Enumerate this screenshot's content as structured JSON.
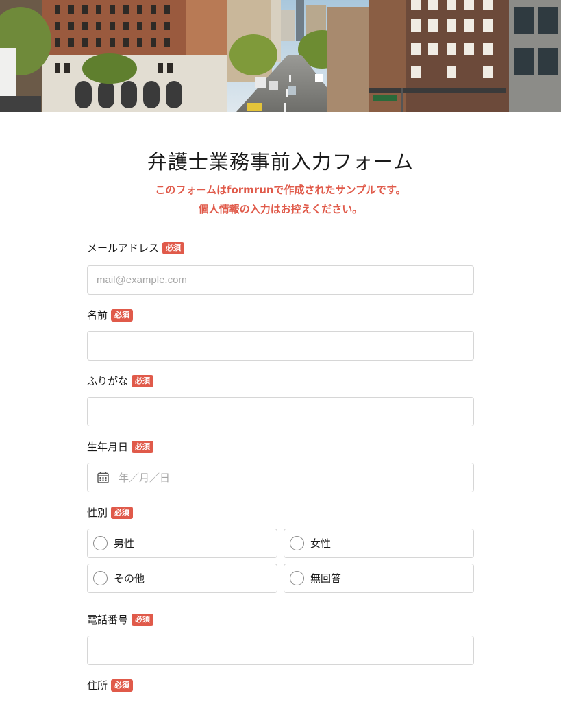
{
  "form": {
    "title": "弁護士業務事前入力フォーム",
    "notice_line1": "このフォームはformrunで作成されたサンプルです。",
    "notice_line2": "個人情報の入力はお控えください。",
    "required_badge": "必須"
  },
  "fields": {
    "email": {
      "label": "メールアドレス",
      "placeholder": "mail@example.com"
    },
    "name": {
      "label": "名前"
    },
    "furigana": {
      "label": "ふりがな"
    },
    "birthdate": {
      "label": "生年月日",
      "placeholder": "年／月／日"
    },
    "gender": {
      "label": "性別",
      "options": [
        "男性",
        "女性",
        "その他",
        "無回答"
      ]
    },
    "phone": {
      "label": "電話番号"
    },
    "address": {
      "label": "住所"
    }
  },
  "colors": {
    "accent": "#e05a4a",
    "border": "#d6d6d6"
  },
  "icons": {
    "date": "calendar-icon"
  }
}
